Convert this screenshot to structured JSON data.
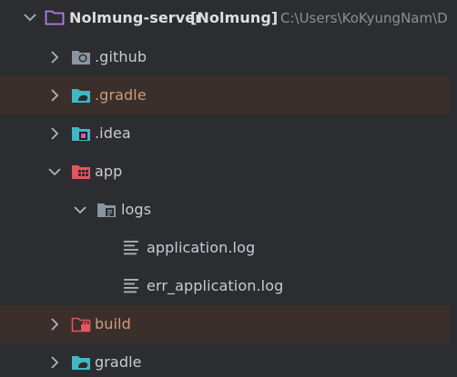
{
  "tree": {
    "root": {
      "label": "Nolmung-server",
      "module": "[Nolmung]",
      "path": "C:\\Users\\KoKyungNam\\D"
    },
    "items": [
      {
        "label": ".github",
        "icon": "github-folder-icon",
        "expanded": false,
        "excluded": false
      },
      {
        "label": ".gradle",
        "icon": "gradle-folder-icon",
        "expanded": false,
        "excluded": true
      },
      {
        "label": ".idea",
        "icon": "idea-folder-icon",
        "expanded": false,
        "excluded": false
      },
      {
        "label": "app",
        "icon": "module-folder-icon",
        "expanded": true,
        "excluded": false
      },
      {
        "label": "logs",
        "icon": "logs-folder-icon",
        "expanded": true,
        "excluded": false
      },
      {
        "label": "application.log",
        "icon": "log-file-icon",
        "expanded": null,
        "excluded": false
      },
      {
        "label": "err_application.log",
        "icon": "log-file-icon",
        "expanded": null,
        "excluded": false
      },
      {
        "label": "build",
        "icon": "build-folder-icon",
        "expanded": false,
        "excluded": true
      },
      {
        "label": "gradle",
        "icon": "gradle-folder-icon",
        "expanded": false,
        "excluded": false
      }
    ]
  },
  "colors": {
    "background": "#2b2d30",
    "excluded_row": "#3a2f2b",
    "excluded_text": "#d19a75",
    "text": "#c9cbd1",
    "muted_text": "#8c8f94",
    "folder_gray": "#8a95a3",
    "folder_teal": "#3fb8c4",
    "folder_red": "#e5545f"
  }
}
